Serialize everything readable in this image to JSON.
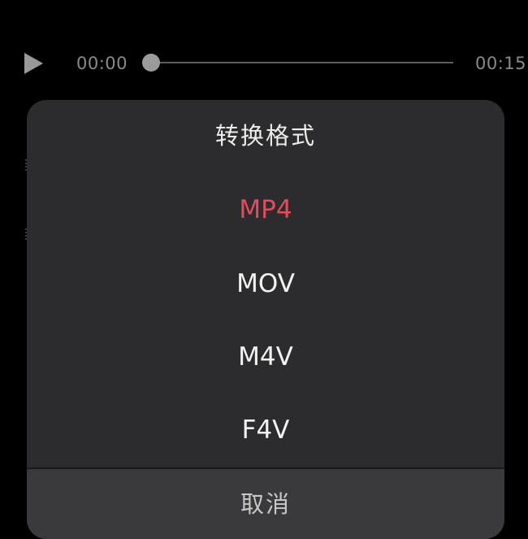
{
  "player": {
    "play_icon": "play-icon",
    "current_time": "00:00",
    "total_time": "00:15",
    "progress_fraction": 0.0
  },
  "sheet": {
    "title": "转换格式",
    "options": [
      {
        "label": "MP4",
        "selected": true
      },
      {
        "label": "MOV",
        "selected": false
      },
      {
        "label": "M4V",
        "selected": false
      },
      {
        "label": "F4V",
        "selected": false
      }
    ],
    "cancel_label": "取消"
  },
  "colors": {
    "background": "#000000",
    "sheet_background": "#2c2c2e",
    "selected_option": "#e24c5c",
    "option_text": "#f2f2f2",
    "muted_text": "#8a8a8a"
  }
}
